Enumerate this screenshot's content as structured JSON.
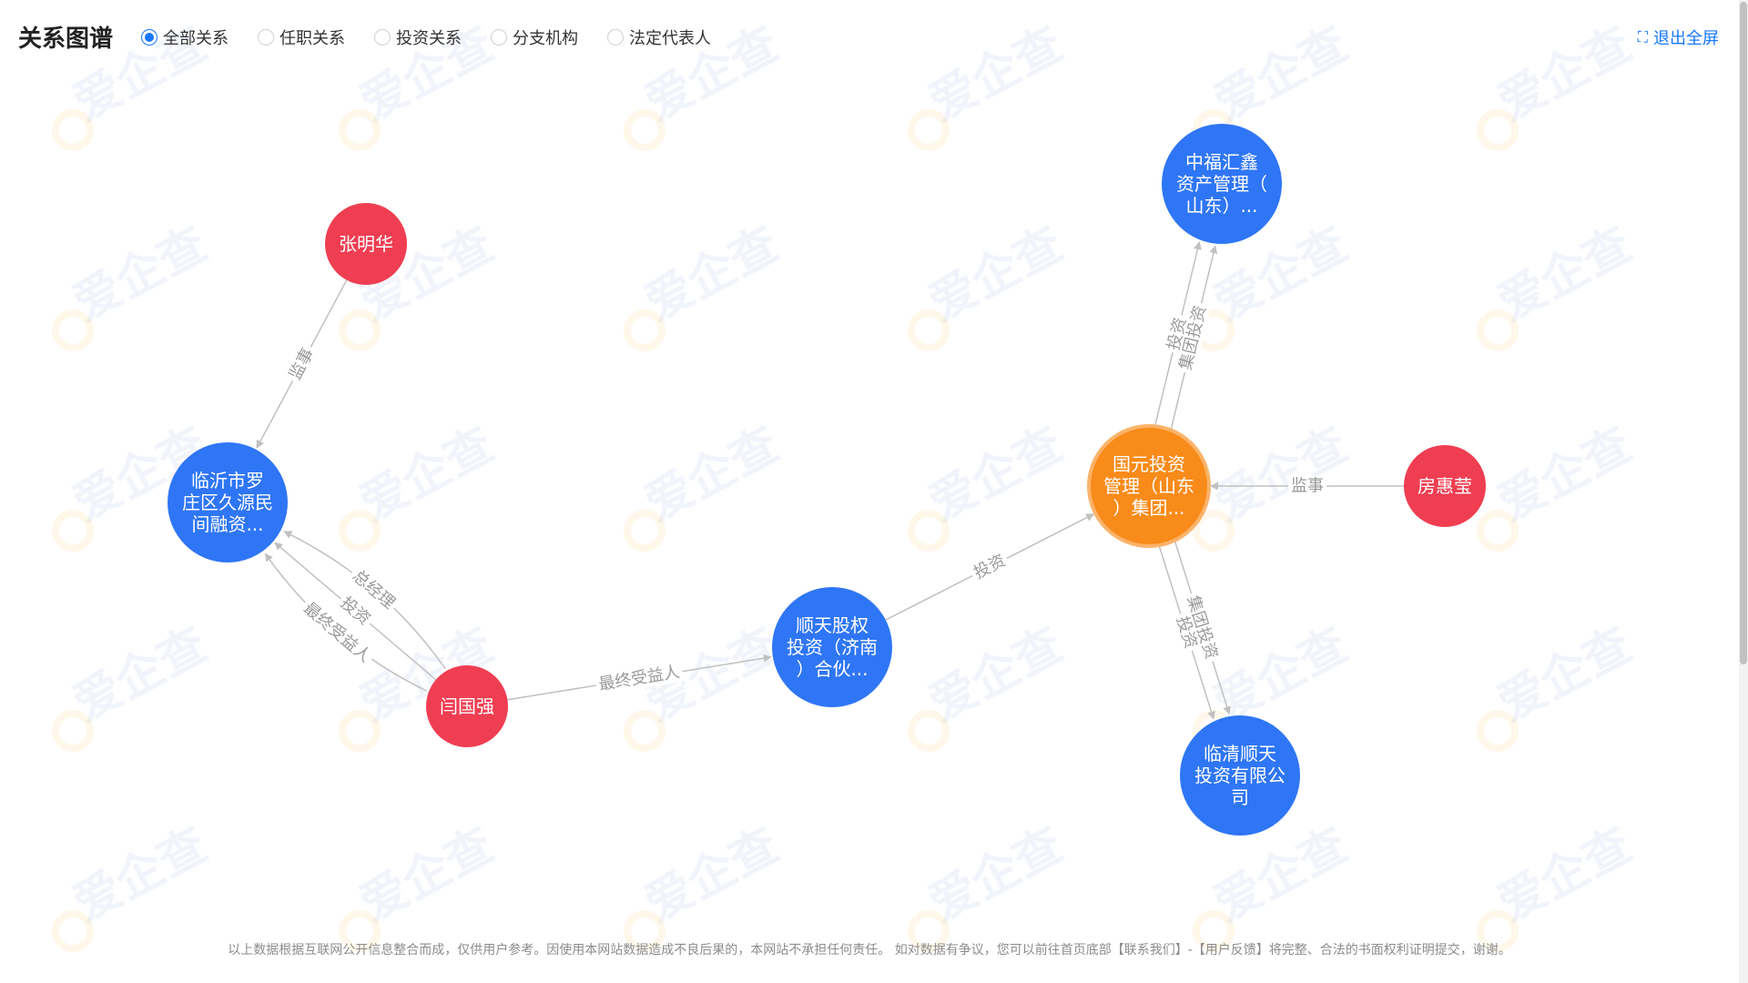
{
  "header": {
    "title": "关系图谱",
    "filters": [
      {
        "label": "全部关系",
        "checked": true
      },
      {
        "label": "任职关系",
        "checked": false
      },
      {
        "label": "投资关系",
        "checked": false
      },
      {
        "label": "分支机构",
        "checked": false
      },
      {
        "label": "法定代表人",
        "checked": false
      }
    ],
    "exit_fullscreen": "退出全屏"
  },
  "watermark": "爱企查",
  "colors": {
    "person": "#ef3e52",
    "company": "#2f76f6",
    "center": "#f98b1a",
    "edge": "#c0c0c0",
    "accent": "#1677ff"
  },
  "graph": {
    "nodes": [
      {
        "id": "zhangminghua",
        "type": "person",
        "lines": [
          "张明华"
        ]
      },
      {
        "id": "linyi",
        "type": "company",
        "lines": [
          "临沂市罗",
          "庄区久源民",
          "间融资..."
        ]
      },
      {
        "id": "yanguoqiang",
        "type": "person",
        "lines": [
          "闫国强"
        ]
      },
      {
        "id": "shuntian",
        "type": "company",
        "lines": [
          "顺天股权",
          "投资（济南",
          "）合伙..."
        ]
      },
      {
        "id": "guoyuan",
        "type": "center",
        "lines": [
          "国元投资",
          "管理（山东",
          "）集团..."
        ]
      },
      {
        "id": "zhongfu",
        "type": "company",
        "lines": [
          "中福汇鑫",
          "资产管理（",
          "山东）..."
        ]
      },
      {
        "id": "fanghuiying",
        "type": "person",
        "lines": [
          "房惠莹"
        ]
      },
      {
        "id": "linqing",
        "type": "company",
        "lines": [
          "临清顺天",
          "投资有限公",
          "司"
        ]
      }
    ],
    "edges": [
      {
        "from": "zhangminghua",
        "to": "linyi",
        "label": "监事"
      },
      {
        "from": "yanguoqiang",
        "to": "linyi",
        "label": "最终受益人"
      },
      {
        "from": "yanguoqiang",
        "to": "linyi",
        "label": "投资"
      },
      {
        "from": "yanguoqiang",
        "to": "linyi",
        "label": "总经理"
      },
      {
        "from": "yanguoqiang",
        "to": "shuntian",
        "label": "最终受益人"
      },
      {
        "from": "shuntian",
        "to": "guoyuan",
        "label": "投资"
      },
      {
        "from": "guoyuan",
        "to": "zhongfu",
        "label": "投资"
      },
      {
        "from": "guoyuan",
        "to": "zhongfu",
        "label": "集团投资"
      },
      {
        "from": "fanghuiying",
        "to": "guoyuan",
        "label": "监事"
      },
      {
        "from": "guoyuan",
        "to": "linqing",
        "label": "集团投资"
      },
      {
        "from": "guoyuan",
        "to": "linqing",
        "label": "投资"
      }
    ]
  },
  "footer": "以上数据根据互联网公开信息整合而成，仅供用户参考。因使用本网站数据造成不良后果的，本网站不承担任何责任。 如对数据有争议，您可以前往首页底部【联系我们】-【用户反馈】将完整、合法的书面权利证明提交，谢谢。"
}
